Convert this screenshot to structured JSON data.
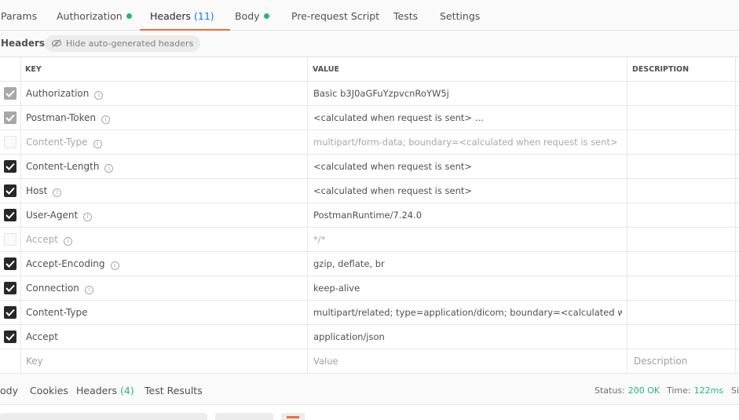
{
  "request_tabs": [
    {
      "label": "Params",
      "count": "",
      "dot": false
    },
    {
      "label": "Authorization",
      "count": "",
      "dot": true
    },
    {
      "label": "Headers",
      "count": "(11)",
      "dot": false
    },
    {
      "label": "Body",
      "count": "",
      "dot": true
    },
    {
      "label": "Pre-request Script",
      "count": "",
      "dot": false
    },
    {
      "label": "Tests",
      "count": "",
      "dot": false
    },
    {
      "label": "Settings",
      "count": "",
      "dot": false
    }
  ],
  "active_request_tab": "Headers",
  "sub_header": {
    "title": "Headers",
    "hide_button": "Hide auto-generated headers"
  },
  "table": {
    "columns": {
      "key": "KEY",
      "value": "VALUE",
      "description": "DESCRIPTION"
    },
    "rows": [
      {
        "key": "Authorization",
        "value": "Basic b3J0aGFuYzpvcnRoYW5j",
        "state": "auto",
        "info": true
      },
      {
        "key": "Postman-Token",
        "value": "<calculated when request is sent> ...",
        "state": "auto",
        "info": true
      },
      {
        "key": "Content-Type",
        "value": "multipart/form-data; boundary=<calculated when request is sent> ...",
        "state": "off",
        "info": true
      },
      {
        "key": "Content-Length",
        "value": "<calculated when request is sent>",
        "state": "on",
        "info": true
      },
      {
        "key": "Host",
        "value": "<calculated when request is sent>",
        "state": "on",
        "info": true
      },
      {
        "key": "User-Agent",
        "value": "PostmanRuntime/7.24.0",
        "state": "on",
        "info": true
      },
      {
        "key": "Accept",
        "value": "*/*",
        "state": "off",
        "info": true
      },
      {
        "key": "Accept-Encoding",
        "value": "gzip, deflate, br",
        "state": "on",
        "info": true
      },
      {
        "key": "Connection",
        "value": "keep-alive",
        "state": "on",
        "info": true
      },
      {
        "key": "Content-Type",
        "value": "multipart/related; type=application/dicom; boundary=<calculated wh...",
        "state": "on",
        "info": false
      },
      {
        "key": "Accept",
        "value": "application/json",
        "state": "on",
        "info": false
      }
    ],
    "placeholders": {
      "key": "Key",
      "value": "Value",
      "description": "Description"
    }
  },
  "response_tabs": [
    {
      "label": "ody",
      "count": ""
    },
    {
      "label": "Cookies",
      "count": ""
    },
    {
      "label": "Headers",
      "count": "(4)"
    },
    {
      "label": "Test Results",
      "count": ""
    }
  ],
  "status": {
    "status_label": "Status:",
    "status_value": "200 OK",
    "time_label": "Time:",
    "time_value": "122ms",
    "size_label": "Si"
  },
  "colors": {
    "accent": "#f26b3a",
    "success": "#26b47f",
    "count_blue": "#097bed"
  }
}
